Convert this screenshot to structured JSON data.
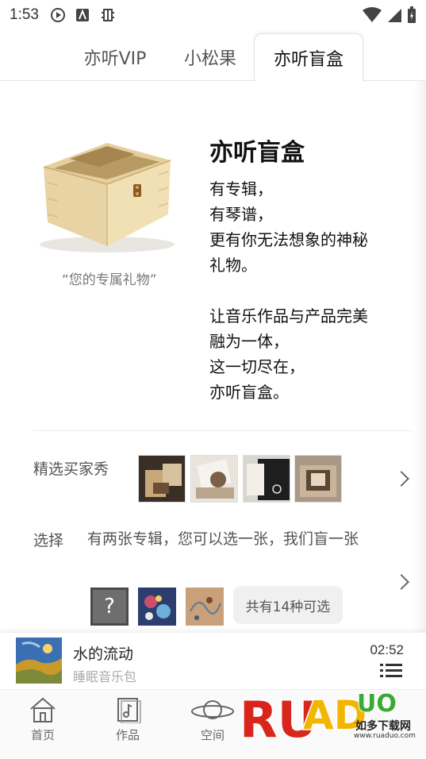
{
  "status_bar": {
    "time": "1:53"
  },
  "tabs": [
    {
      "label": "亦听VIP"
    },
    {
      "label": "小松果"
    },
    {
      "label": "亦听盲盒",
      "active": true
    }
  ],
  "blindbox": {
    "title": "亦听盲盒",
    "caption": "“您的专属礼物”",
    "desc_lines_1": [
      "有专辑，",
      "有琴谱，",
      "更有你无法想象的神秘",
      "礼物。"
    ],
    "desc_lines_2": [
      "让音乐作品与产品完美",
      "融为一体，",
      "这一切尽在，",
      "亦听盲盒。"
    ]
  },
  "buyer_show": {
    "label": "精选买家秀",
    "thumb_count": 4
  },
  "choose": {
    "label": "选择",
    "text": "有两张专辑，您可以选一张，我们盲一张",
    "mystery_mark": "?",
    "count_label": "共有14种可选"
  },
  "player": {
    "track_title": "水的流动",
    "album": "睡眠音乐包",
    "time": "02:52"
  },
  "nav": {
    "items": [
      {
        "label": "首页",
        "icon": "home-icon"
      },
      {
        "label": "作品",
        "icon": "music-note-icon"
      },
      {
        "label": "空间",
        "icon": "planet-icon"
      }
    ]
  },
  "watermark": {
    "brand": "RUANDUO",
    "subtitle": "如多下载网",
    "url": "www.ruaduo.com"
  },
  "colors": {
    "accent_red": "#d9261c",
    "watermark_green": "#3aa935",
    "watermark_yellow": "#f2b600"
  }
}
